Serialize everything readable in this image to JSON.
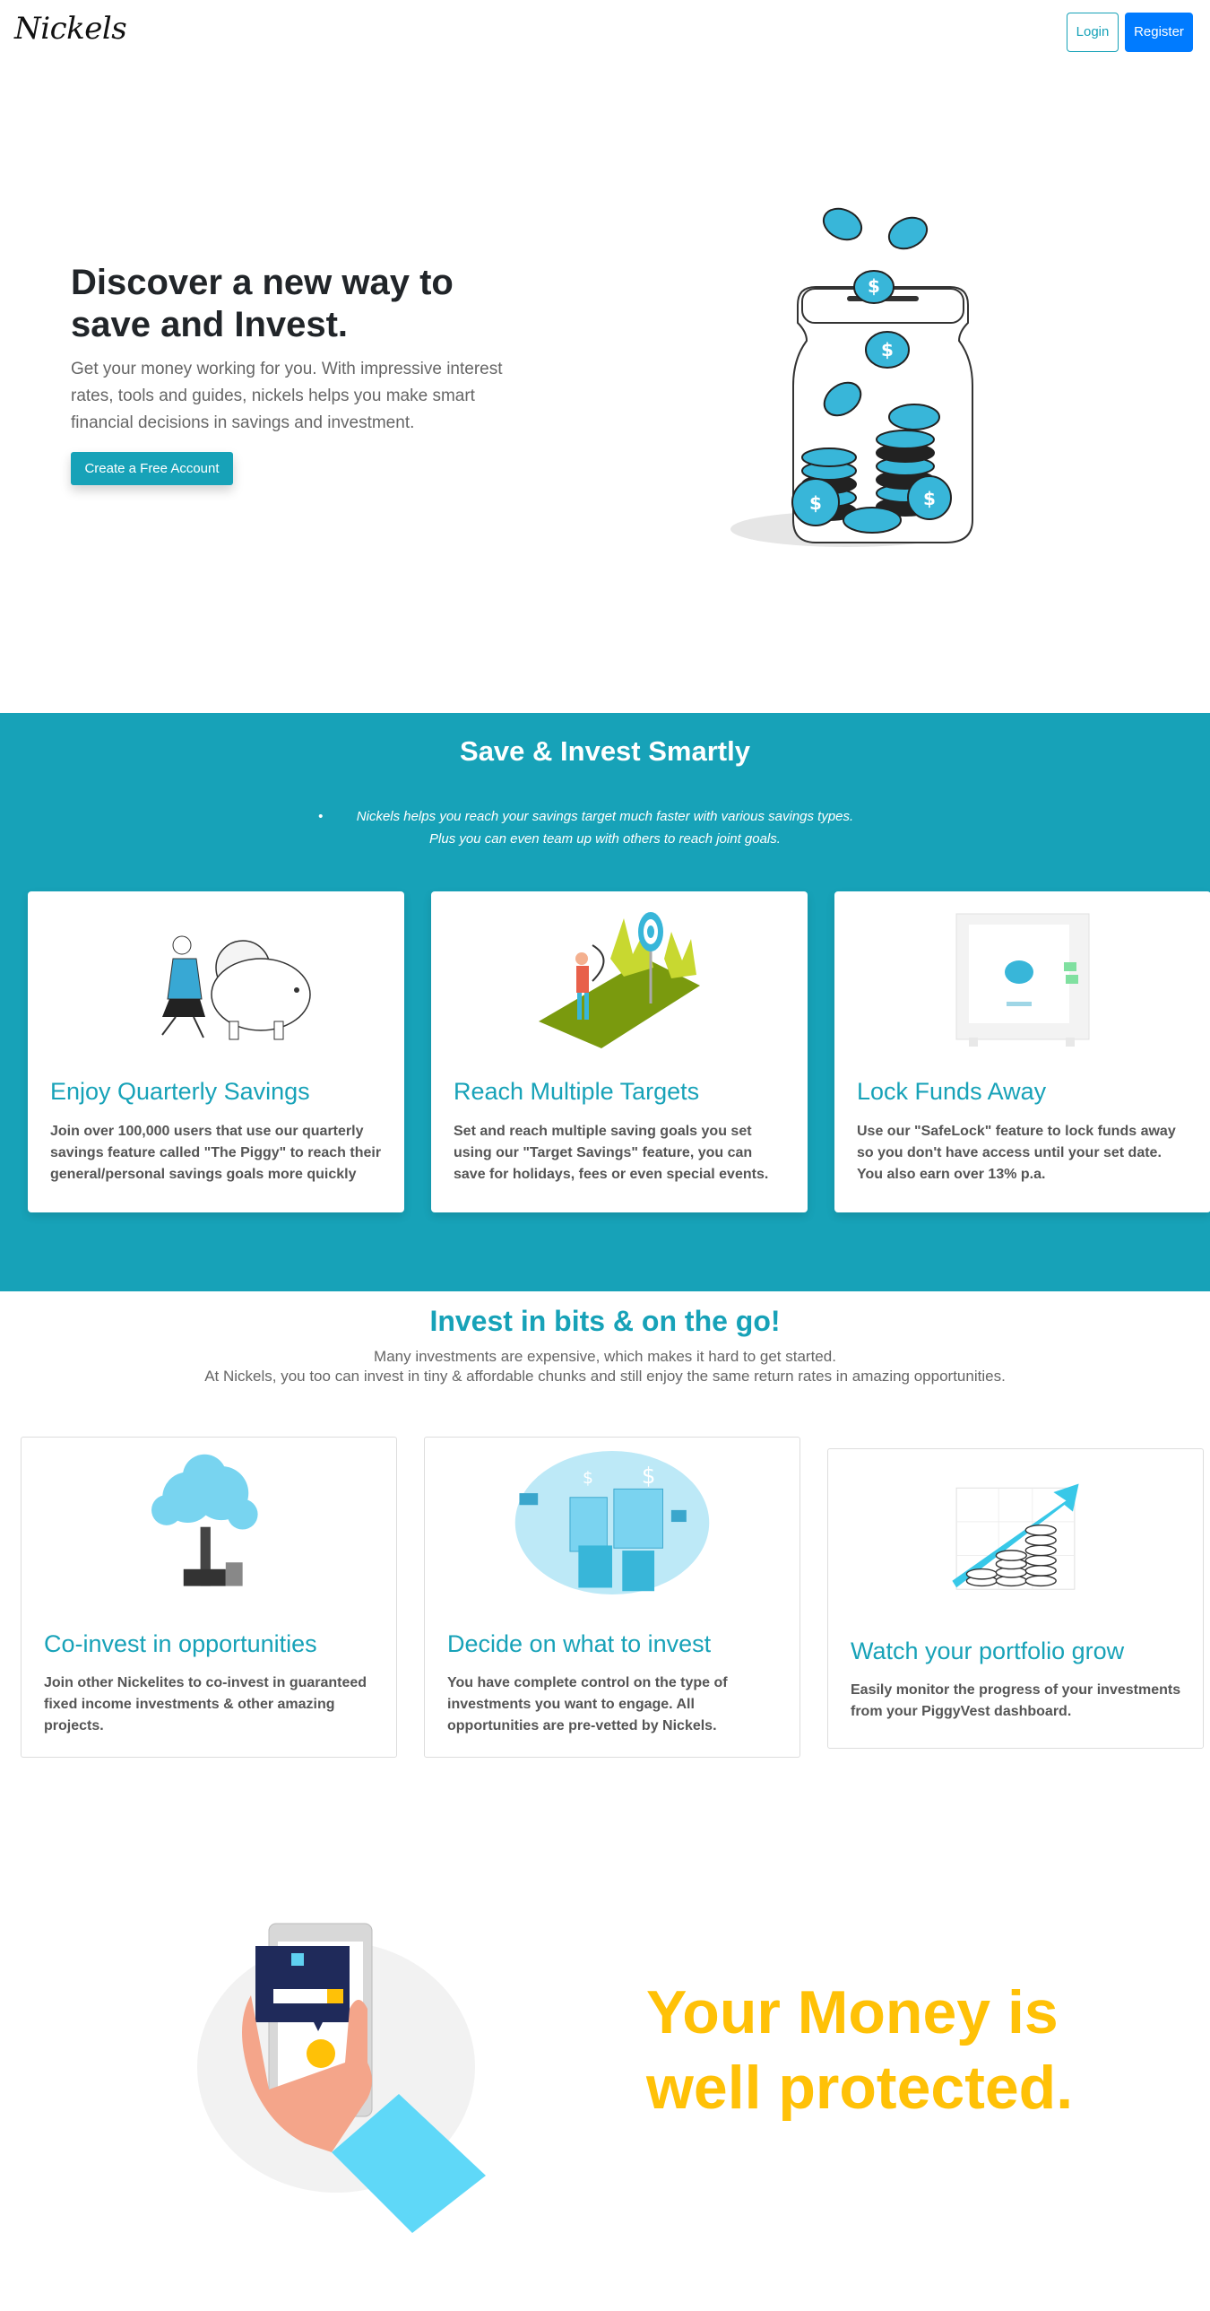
{
  "nav": {
    "brand": "Nickels",
    "login_label": "Login",
    "register_label": "Register"
  },
  "hero": {
    "title": "Discover a new way to save and Invest.",
    "text": "Get your money working for you. With impressive interest rates, tools and guides, nickels helps you make smart financial decisions in savings and investment.",
    "cta_label": "Create a Free Account",
    "illustration": "coin-jar-illustration"
  },
  "save": {
    "title": "Save & Invest Smartly",
    "desc_line1": "Nickels helps you reach your savings target much faster with various savings types.",
    "desc_line2": "Plus you can even team up with others to reach joint goals.",
    "cards": [
      {
        "title": "Enjoy Quarterly Savings",
        "text": "Join over 100,000 users that use our quarterly savings feature called \"The Piggy\" to reach their general/personal savings goals more quickly",
        "icon": "piggy-bank-illustration"
      },
      {
        "title": "Reach Multiple Targets",
        "text": "Set and reach multiple saving goals you set using our \"Target Savings\" feature, you can save for holidays, fees or even special events.",
        "icon": "archery-target-illustration"
      },
      {
        "title": "Lock Funds Away",
        "text": "Use our \"SafeLock\" feature to lock funds away so you don't have access until your set date. You also earn over 13% p.a.",
        "icon": "safe-illustration"
      }
    ]
  },
  "invest": {
    "title": "Invest in bits & on the go!",
    "sub_line1": "Many investments are expensive, which makes it hard to get started.",
    "sub_line2": "At Nickels, you too can invest in tiny & affordable chunks and still enjoy the same return rates in amazing opportunities.",
    "cards": [
      {
        "title": "Co-invest in opportunities",
        "text": "Join other Nickelites to co-invest in guaranteed fixed income investments & other amazing projects.",
        "icon": "money-tree-illustration"
      },
      {
        "title": "Decide on what to invest",
        "text": "You have complete control on the type of investments you want to engage. All opportunities are pre-vetted by Nickels.",
        "icon": "calculator-illustration"
      },
      {
        "title": "Watch your portfolio grow",
        "text": "Easily monitor the progress of your investments from your PiggyVest dashboard.",
        "icon": "growth-chart-illustration"
      }
    ]
  },
  "protected": {
    "line1": "Your Money is",
    "line2": "well protected.",
    "icon": "secure-phone-illustration"
  },
  "colors": {
    "accent": "#17a2b8",
    "primary": "#007bff",
    "warning": "#ffc107"
  }
}
